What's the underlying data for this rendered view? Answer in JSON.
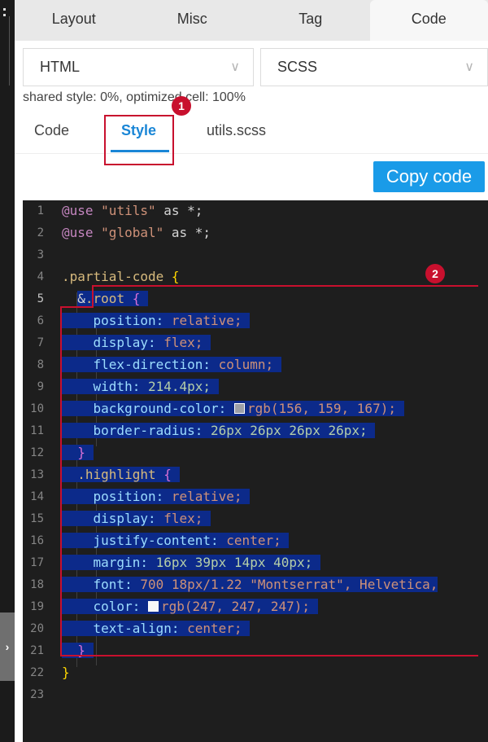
{
  "tabs": [
    "Layout",
    "Misc",
    "Tag",
    "Code"
  ],
  "active_tab": "Code",
  "selects": {
    "left": "HTML",
    "right": "SCSS"
  },
  "stat_text": "shared style: 0%, optimized cell: 100%",
  "subtabs": {
    "code": "Code",
    "style": "Style",
    "utils": "utils.scss"
  },
  "copy_label": "Copy code",
  "annotations": {
    "one": "1",
    "two": "2"
  },
  "lines": {
    "n": [
      "1",
      "2",
      "3",
      "4",
      "5",
      "6",
      "7",
      "8",
      "9",
      "10",
      "11",
      "12",
      "13",
      "14",
      "15",
      "16",
      "17",
      "18",
      "19",
      "20",
      "21",
      "22",
      "23"
    ],
    "l1": {
      "at": "@use",
      "str": "\"utils\"",
      "rest": " as *;"
    },
    "l2": {
      "at": "@use",
      "str": "\"global\"",
      "rest": " as *;"
    },
    "l4": {
      "sel": ".partial-code",
      "brace": " {"
    },
    "l5": {
      "amp": "&",
      "sel": ".root",
      "brace": " {"
    },
    "l6": {
      "prop": "position:",
      "val": " relative;"
    },
    "l7": {
      "prop": "display:",
      "val": " flex;"
    },
    "l8": {
      "prop": "flex-direction:",
      "val": " column;"
    },
    "l9": {
      "prop": "width:",
      "val": " 214.4px;"
    },
    "l10": {
      "prop": "background-color:",
      "val": "rgb(156, 159, 167);",
      "swatch": "#9c9fa7"
    },
    "l11": {
      "prop": "border-radius:",
      "val": " 26px 26px 26px 26px;"
    },
    "l12": {
      "brace": "}"
    },
    "l13": {
      "sel": ".highlight",
      "brace": " {"
    },
    "l14": {
      "prop": "position:",
      "val": " relative;"
    },
    "l15": {
      "prop": "display:",
      "val": " flex;"
    },
    "l16": {
      "prop": "justify-content:",
      "val": " center;"
    },
    "l17": {
      "prop": "margin:",
      "val": " 16px 39px 14px 40px;"
    },
    "l18": {
      "prop": "font:",
      "val": " 700 18px/1.22 \"Montserrat\", Helvetica,"
    },
    "l19": {
      "prop": "color:",
      "val": "rgb(247, 247, 247);",
      "swatch": "#f7f7f7"
    },
    "l20": {
      "prop": "text-align:",
      "val": " center;"
    },
    "l21": {
      "brace": "}"
    },
    "l22": {
      "brace": "}"
    }
  }
}
